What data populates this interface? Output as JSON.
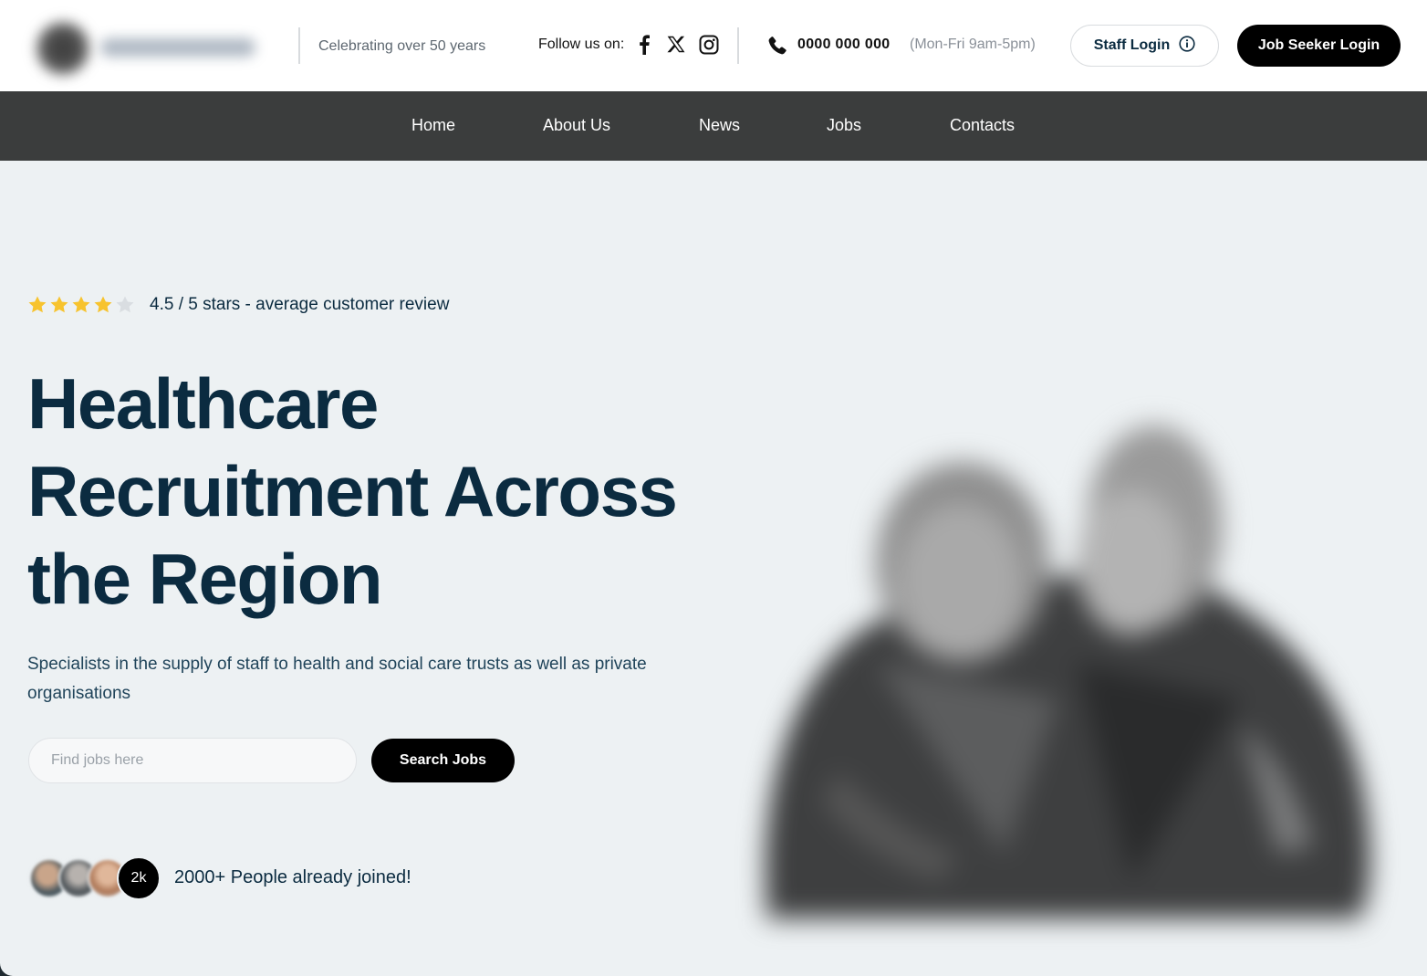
{
  "header": {
    "tagline": "Celebrating over 50 years",
    "follow_label": "Follow us on:",
    "social_icons": [
      "facebook-icon",
      "x-icon",
      "instagram-icon"
    ],
    "phone_number": "0000 000 000",
    "phone_hours": "(Mon-Fri 9am-5pm)",
    "staff_login_label": "Staff Login",
    "job_seeker_login_label": "Job Seeker Login"
  },
  "nav": {
    "items": [
      {
        "label": "Home"
      },
      {
        "label": "About Us"
      },
      {
        "label": "News"
      },
      {
        "label": "Jobs"
      },
      {
        "label": "Contacts"
      }
    ]
  },
  "hero": {
    "rating": {
      "value": 4.5,
      "max": 5,
      "text": "4.5 / 5 stars - average customer review"
    },
    "headline_lines": [
      "Healthcare",
      "Recruitment Across",
      "the Region"
    ],
    "subtitle": "Specialists in the supply of staff to health and social care trusts as well as private organisations",
    "search": {
      "placeholder": "Find jobs here",
      "button_label": "Search Jobs"
    },
    "social_proof": {
      "count_badge": "2k",
      "text": "2000+ People already joined!"
    }
  },
  "colors": {
    "navy": "#0b2b40",
    "nav_bg": "#3b3d3d",
    "hero_bg": "#edf1f3",
    "star": "#f7c32e",
    "star_empty": "#d9dde1",
    "button_dark": "#000000"
  }
}
